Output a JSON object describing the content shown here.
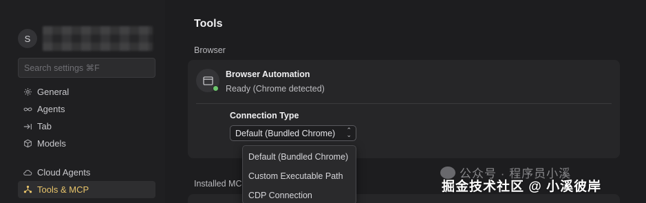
{
  "sidebar": {
    "avatar_initial": "S",
    "search_placeholder": "Search settings ⌘F",
    "group1": [
      {
        "label": "General",
        "icon": "gear-icon"
      },
      {
        "label": "Agents",
        "icon": "infinity-icon"
      },
      {
        "label": "Tab",
        "icon": "tab-arrow-icon"
      },
      {
        "label": "Models",
        "icon": "cube-icon"
      }
    ],
    "group2": [
      {
        "label": "Cloud Agents",
        "icon": "cloud-icon"
      },
      {
        "label": "Tools & MCP",
        "icon": "tools-icon",
        "active": true
      }
    ]
  },
  "main": {
    "title": "Tools",
    "section_browser": "Browser",
    "section_installed": "Installed MC",
    "browser_card": {
      "title": "Browser Automation",
      "status": "Ready (Chrome detected)",
      "connection_label": "Connection Type",
      "selected_value": "Default (Bundled Chrome)"
    },
    "dropdown_options": [
      "Default (Bundled Chrome)",
      "Custom Executable Path",
      "CDP Connection"
    ]
  },
  "watermark": {
    "line1": "公众号 · 程序员小溪",
    "line2": "掘金技术社区 @ 小溪彼岸"
  },
  "colors": {
    "accent": "#e8c46a",
    "status_ready": "#6cc66c",
    "background": "#1d1d1f",
    "card": "#262628"
  }
}
